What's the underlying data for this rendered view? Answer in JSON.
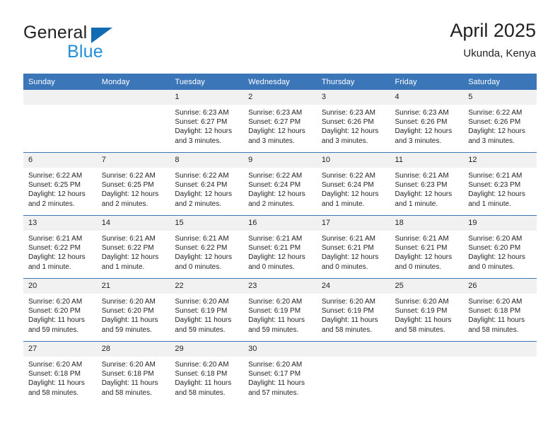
{
  "brand": {
    "name_part1": "General",
    "name_part2": "Blue",
    "logo_icon": "triangle-logo-icon"
  },
  "header": {
    "title": "April 2025",
    "subtitle": "Ukunda, Kenya"
  },
  "colors": {
    "header_blue": "#3b77b8",
    "brand_blue": "#1f8fdb",
    "logo_blue": "#136cb2",
    "daynum_band": "#f1f1f1",
    "text": "#231f20"
  },
  "weekdays": [
    "Sunday",
    "Monday",
    "Tuesday",
    "Wednesday",
    "Thursday",
    "Friday",
    "Saturday"
  ],
  "labels": {
    "sunrise": "Sunrise:",
    "sunset": "Sunset:",
    "daylight": "Daylight:"
  },
  "weeks": [
    [
      {
        "day": "",
        "empty": true
      },
      {
        "day": "",
        "empty": true
      },
      {
        "day": "1",
        "sunrise": "Sunrise: 6:23 AM",
        "sunset": "Sunset: 6:27 PM",
        "daylight_1": "Daylight: 12 hours",
        "daylight_2": "and 3 minutes."
      },
      {
        "day": "2",
        "sunrise": "Sunrise: 6:23 AM",
        "sunset": "Sunset: 6:27 PM",
        "daylight_1": "Daylight: 12 hours",
        "daylight_2": "and 3 minutes."
      },
      {
        "day": "3",
        "sunrise": "Sunrise: 6:23 AM",
        "sunset": "Sunset: 6:26 PM",
        "daylight_1": "Daylight: 12 hours",
        "daylight_2": "and 3 minutes."
      },
      {
        "day": "4",
        "sunrise": "Sunrise: 6:23 AM",
        "sunset": "Sunset: 6:26 PM",
        "daylight_1": "Daylight: 12 hours",
        "daylight_2": "and 3 minutes."
      },
      {
        "day": "5",
        "sunrise": "Sunrise: 6:22 AM",
        "sunset": "Sunset: 6:26 PM",
        "daylight_1": "Daylight: 12 hours",
        "daylight_2": "and 3 minutes."
      }
    ],
    [
      {
        "day": "6",
        "sunrise": "Sunrise: 6:22 AM",
        "sunset": "Sunset: 6:25 PM",
        "daylight_1": "Daylight: 12 hours",
        "daylight_2": "and 2 minutes."
      },
      {
        "day": "7",
        "sunrise": "Sunrise: 6:22 AM",
        "sunset": "Sunset: 6:25 PM",
        "daylight_1": "Daylight: 12 hours",
        "daylight_2": "and 2 minutes."
      },
      {
        "day": "8",
        "sunrise": "Sunrise: 6:22 AM",
        "sunset": "Sunset: 6:24 PM",
        "daylight_1": "Daylight: 12 hours",
        "daylight_2": "and 2 minutes."
      },
      {
        "day": "9",
        "sunrise": "Sunrise: 6:22 AM",
        "sunset": "Sunset: 6:24 PM",
        "daylight_1": "Daylight: 12 hours",
        "daylight_2": "and 2 minutes."
      },
      {
        "day": "10",
        "sunrise": "Sunrise: 6:22 AM",
        "sunset": "Sunset: 6:24 PM",
        "daylight_1": "Daylight: 12 hours",
        "daylight_2": "and 1 minute."
      },
      {
        "day": "11",
        "sunrise": "Sunrise: 6:21 AM",
        "sunset": "Sunset: 6:23 PM",
        "daylight_1": "Daylight: 12 hours",
        "daylight_2": "and 1 minute."
      },
      {
        "day": "12",
        "sunrise": "Sunrise: 6:21 AM",
        "sunset": "Sunset: 6:23 PM",
        "daylight_1": "Daylight: 12 hours",
        "daylight_2": "and 1 minute."
      }
    ],
    [
      {
        "day": "13",
        "sunrise": "Sunrise: 6:21 AM",
        "sunset": "Sunset: 6:22 PM",
        "daylight_1": "Daylight: 12 hours",
        "daylight_2": "and 1 minute."
      },
      {
        "day": "14",
        "sunrise": "Sunrise: 6:21 AM",
        "sunset": "Sunset: 6:22 PM",
        "daylight_1": "Daylight: 12 hours",
        "daylight_2": "and 1 minute."
      },
      {
        "day": "15",
        "sunrise": "Sunrise: 6:21 AM",
        "sunset": "Sunset: 6:22 PM",
        "daylight_1": "Daylight: 12 hours",
        "daylight_2": "and 0 minutes."
      },
      {
        "day": "16",
        "sunrise": "Sunrise: 6:21 AM",
        "sunset": "Sunset: 6:21 PM",
        "daylight_1": "Daylight: 12 hours",
        "daylight_2": "and 0 minutes."
      },
      {
        "day": "17",
        "sunrise": "Sunrise: 6:21 AM",
        "sunset": "Sunset: 6:21 PM",
        "daylight_1": "Daylight: 12 hours",
        "daylight_2": "and 0 minutes."
      },
      {
        "day": "18",
        "sunrise": "Sunrise: 6:21 AM",
        "sunset": "Sunset: 6:21 PM",
        "daylight_1": "Daylight: 12 hours",
        "daylight_2": "and 0 minutes."
      },
      {
        "day": "19",
        "sunrise": "Sunrise: 6:20 AM",
        "sunset": "Sunset: 6:20 PM",
        "daylight_1": "Daylight: 12 hours",
        "daylight_2": "and 0 minutes."
      }
    ],
    [
      {
        "day": "20",
        "sunrise": "Sunrise: 6:20 AM",
        "sunset": "Sunset: 6:20 PM",
        "daylight_1": "Daylight: 11 hours",
        "daylight_2": "and 59 minutes."
      },
      {
        "day": "21",
        "sunrise": "Sunrise: 6:20 AM",
        "sunset": "Sunset: 6:20 PM",
        "daylight_1": "Daylight: 11 hours",
        "daylight_2": "and 59 minutes."
      },
      {
        "day": "22",
        "sunrise": "Sunrise: 6:20 AM",
        "sunset": "Sunset: 6:19 PM",
        "daylight_1": "Daylight: 11 hours",
        "daylight_2": "and 59 minutes."
      },
      {
        "day": "23",
        "sunrise": "Sunrise: 6:20 AM",
        "sunset": "Sunset: 6:19 PM",
        "daylight_1": "Daylight: 11 hours",
        "daylight_2": "and 59 minutes."
      },
      {
        "day": "24",
        "sunrise": "Sunrise: 6:20 AM",
        "sunset": "Sunset: 6:19 PM",
        "daylight_1": "Daylight: 11 hours",
        "daylight_2": "and 58 minutes."
      },
      {
        "day": "25",
        "sunrise": "Sunrise: 6:20 AM",
        "sunset": "Sunset: 6:19 PM",
        "daylight_1": "Daylight: 11 hours",
        "daylight_2": "and 58 minutes."
      },
      {
        "day": "26",
        "sunrise": "Sunrise: 6:20 AM",
        "sunset": "Sunset: 6:18 PM",
        "daylight_1": "Daylight: 11 hours",
        "daylight_2": "and 58 minutes."
      }
    ],
    [
      {
        "day": "27",
        "sunrise": "Sunrise: 6:20 AM",
        "sunset": "Sunset: 6:18 PM",
        "daylight_1": "Daylight: 11 hours",
        "daylight_2": "and 58 minutes."
      },
      {
        "day": "28",
        "sunrise": "Sunrise: 6:20 AM",
        "sunset": "Sunset: 6:18 PM",
        "daylight_1": "Daylight: 11 hours",
        "daylight_2": "and 58 minutes."
      },
      {
        "day": "29",
        "sunrise": "Sunrise: 6:20 AM",
        "sunset": "Sunset: 6:18 PM",
        "daylight_1": "Daylight: 11 hours",
        "daylight_2": "and 58 minutes."
      },
      {
        "day": "30",
        "sunrise": "Sunrise: 6:20 AM",
        "sunset": "Sunset: 6:17 PM",
        "daylight_1": "Daylight: 11 hours",
        "daylight_2": "and 57 minutes."
      },
      {
        "day": "",
        "empty": true
      },
      {
        "day": "",
        "empty": true
      },
      {
        "day": "",
        "empty": true
      }
    ]
  ]
}
